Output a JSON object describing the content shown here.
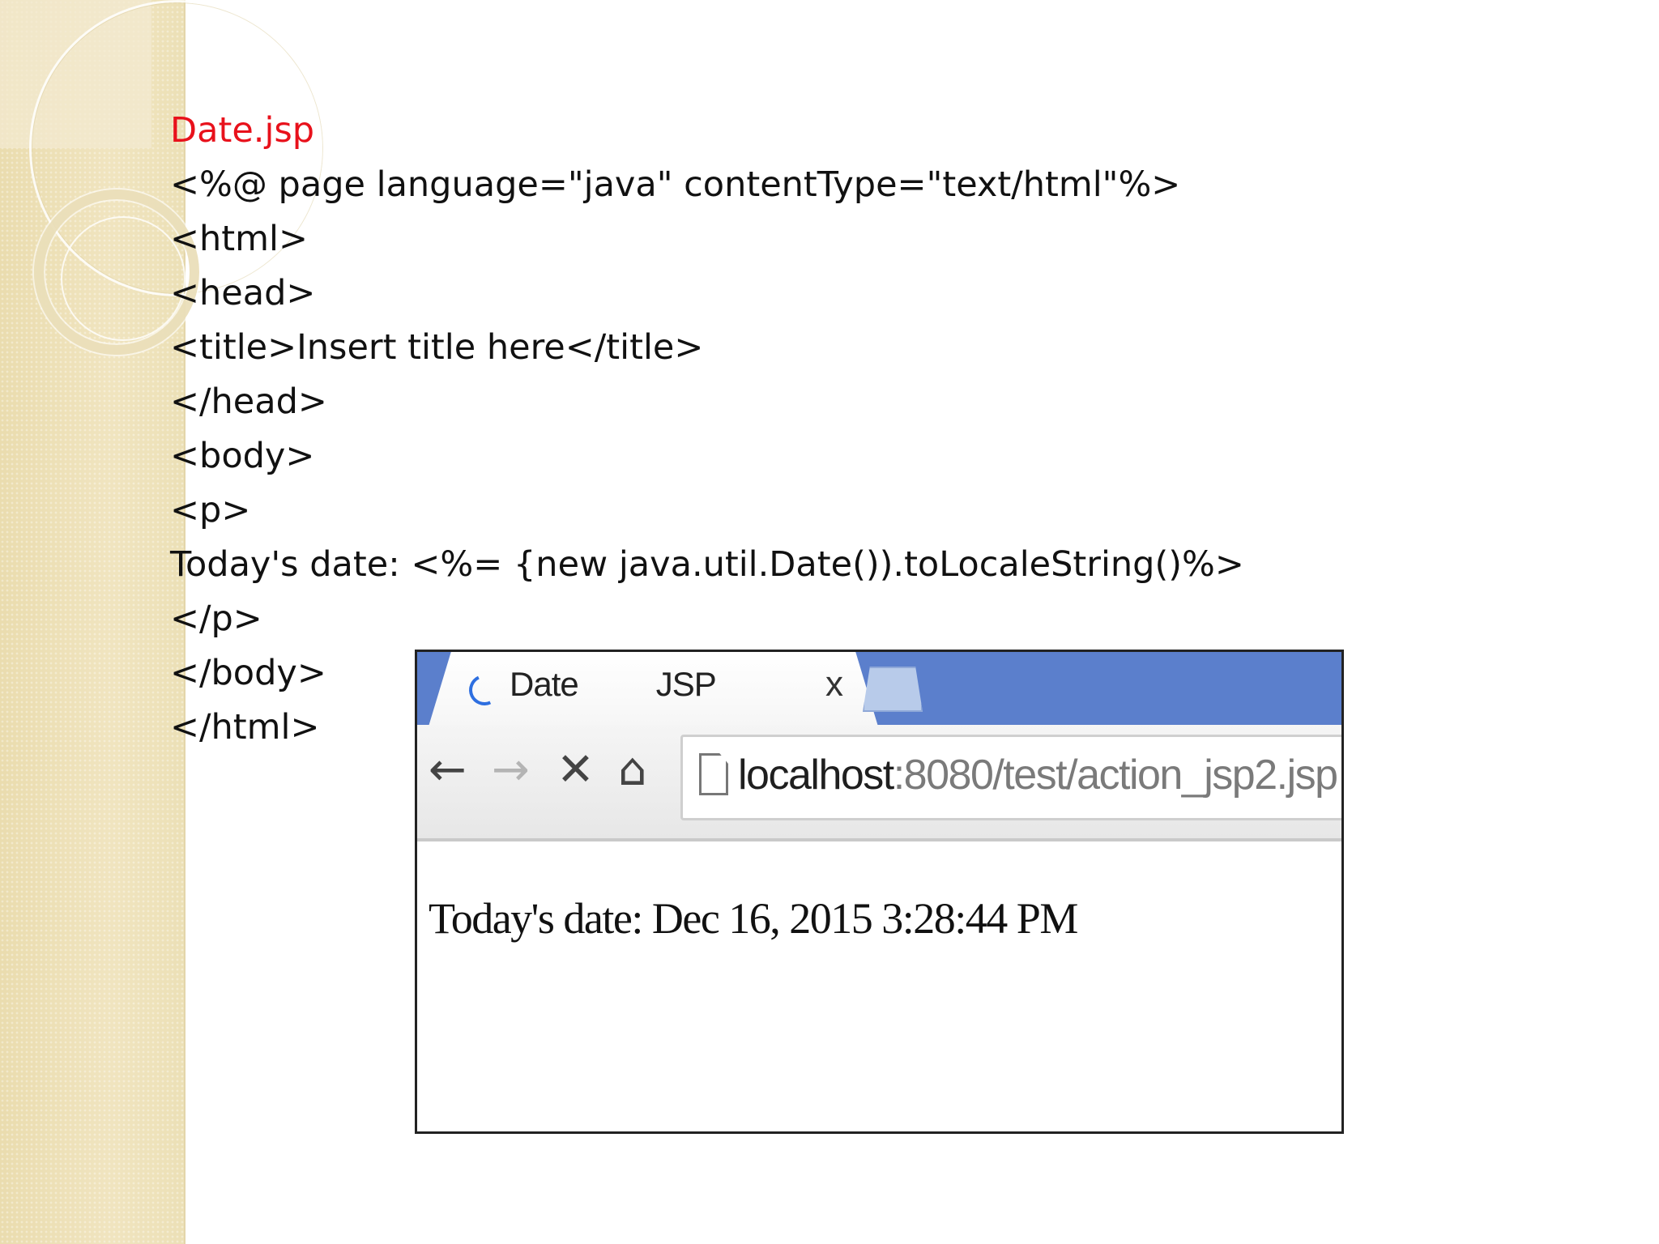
{
  "slide": {
    "code_lines": [
      "Date.jsp",
      "<%@ page language=\"java\" contentType=\"text/html\"%>",
      "<html>",
      "<head>",
      "<title>Insert title here</title>",
      "</head>",
      "<body>",
      "<p>",
      "Today's date: <%= {new java.util.Date()).toLocaleString()%>",
      "</p>",
      "</body>",
      "</html>"
    ]
  },
  "browser": {
    "tab": {
      "title": "Date         JSP",
      "close_glyph": "x"
    },
    "nav": {
      "back": "←",
      "forward": "→",
      "stop": "✕",
      "home": "⌂"
    },
    "address": {
      "host": "localhost",
      "path": ":8080/test/action_jsp2.jsp"
    },
    "page_text": "Today's date: Dec 16, 2015 3:28:44 PM"
  },
  "colors": {
    "title_red": "#e8111b",
    "tabstrip_blue": "#5b7fcc",
    "spinner_blue": "#2e6fe0",
    "side_band": "#efe2bb"
  },
  "icons": {
    "tab_spinner": "loading-spinner-icon",
    "page": "page-icon",
    "back": "back-arrow-icon",
    "forward": "forward-arrow-icon",
    "stop": "close-icon",
    "home": "home-icon"
  }
}
